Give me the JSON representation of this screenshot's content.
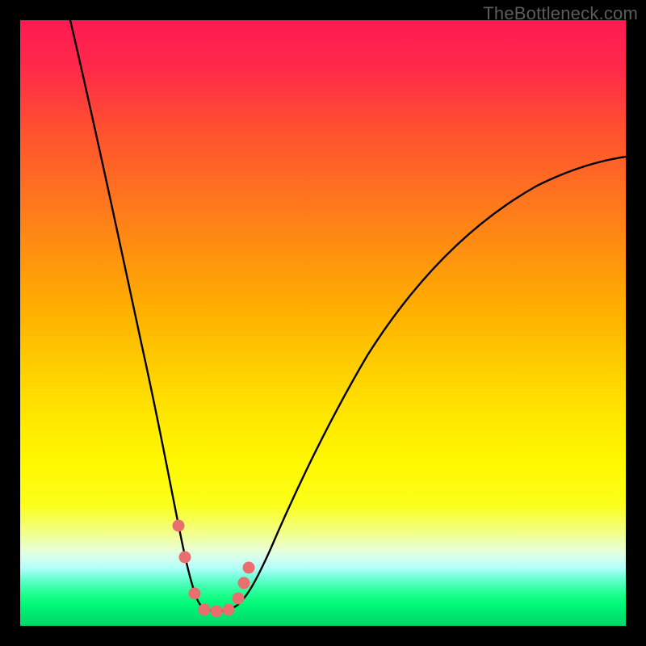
{
  "watermark": "TheBottleneck.com",
  "chart_data": {
    "type": "line",
    "title": "",
    "xlabel": "",
    "ylabel": "",
    "xlim": [
      0,
      100
    ],
    "ylim": [
      0,
      100
    ],
    "grid": false,
    "series": [
      {
        "name": "curve",
        "x": [
          8,
          10,
          12,
          14,
          16,
          18,
          20,
          22,
          23,
          24,
          25,
          26,
          27,
          28,
          29,
          30,
          32,
          34,
          38,
          44,
          52,
          60,
          68,
          76,
          84,
          92,
          100
        ],
        "y": [
          100,
          90,
          80,
          70,
          60,
          50,
          41,
          32,
          27,
          22,
          17,
          12,
          8,
          5,
          2.8,
          2.2,
          2.2,
          2.5,
          5,
          12,
          24,
          36,
          48,
          58,
          66,
          72,
          77
        ]
      }
    ],
    "markers": [
      {
        "x": 25.5,
        "y": 12
      },
      {
        "x": 26.5,
        "y": 8
      },
      {
        "x": 28.5,
        "y": 2.8
      },
      {
        "x": 30,
        "y": 2.2
      },
      {
        "x": 32,
        "y": 2.2
      },
      {
        "x": 34,
        "y": 2.5
      },
      {
        "x": 35.5,
        "y": 4.5
      },
      {
        "x": 36.2,
        "y": 7
      },
      {
        "x": 37,
        "y": 10
      }
    ],
    "marker_color": "#e96f6f",
    "line_color": "#000000",
    "background": "gradient-red-yellow-green"
  }
}
